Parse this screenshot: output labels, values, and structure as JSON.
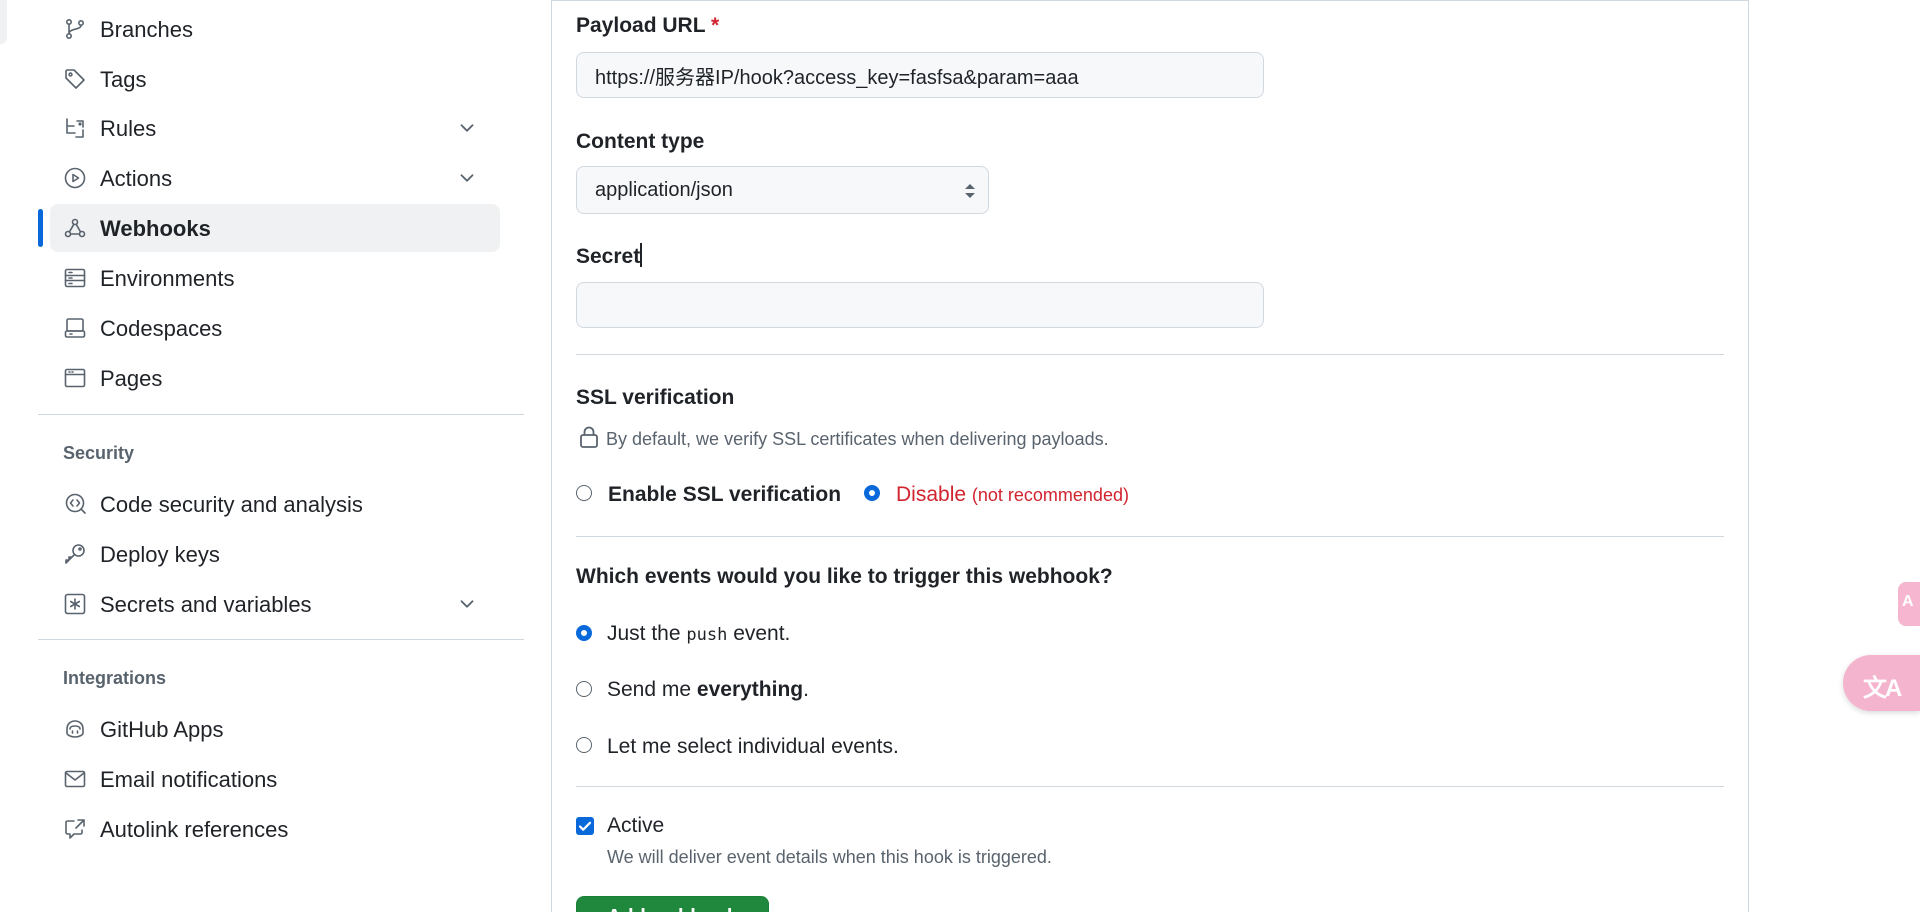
{
  "sidebar": {
    "code_items": [
      {
        "label": "Branches",
        "icon": "git-branch-icon"
      },
      {
        "label": "Tags",
        "icon": "tag-icon"
      },
      {
        "label": "Rules",
        "icon": "rules-icon",
        "expandable": true
      },
      {
        "label": "Actions",
        "icon": "play-icon",
        "expandable": true
      },
      {
        "label": "Webhooks",
        "icon": "webhook-icon",
        "selected": true
      },
      {
        "label": "Environments",
        "icon": "server-icon"
      },
      {
        "label": "Codespaces",
        "icon": "codespaces-icon"
      },
      {
        "label": "Pages",
        "icon": "browser-icon"
      }
    ],
    "security_title": "Security",
    "security_items": [
      {
        "label": "Code security and analysis",
        "icon": "codescan-icon"
      },
      {
        "label": "Deploy keys",
        "icon": "key-icon"
      },
      {
        "label": "Secrets and variables",
        "icon": "asterisk-icon",
        "expandable": true
      }
    ],
    "integrations_title": "Integrations",
    "integrations_items": [
      {
        "label": "GitHub Apps",
        "icon": "copilot-icon"
      },
      {
        "label": "Email notifications",
        "icon": "mail-icon"
      },
      {
        "label": "Autolink references",
        "icon": "cross-reference-icon"
      }
    ]
  },
  "form": {
    "payload_url_label": "Payload URL",
    "required_mark": "*",
    "payload_url_value": "https://服务器IP/hook?access_key=fasfsa&param=aaa",
    "content_type_label": "Content type",
    "content_type_value": "application/json",
    "secret_label": "Secret",
    "secret_value": "",
    "ssl_title": "SSL verification",
    "ssl_note": "By default, we verify SSL certificates when delivering payloads.",
    "ssl_enable_label": "Enable SSL verification",
    "ssl_disable_label": "Disable",
    "ssl_disable_note": "(not recommended)",
    "ssl_selected": "disable",
    "events_title": "Which events would you like to trigger this webhook?",
    "event_push_prefix": "Just the",
    "event_push_code": "push",
    "event_push_suffix": "event.",
    "event_everything_prefix": "Send me",
    "event_everything_strong": "everything",
    "event_everything_suffix": ".",
    "event_individual_label": "Let me select individual events.",
    "events_selected": "push",
    "active_label": "Active",
    "active_checked": true,
    "active_note": "We will deliver event details when this hook is triggered.",
    "add_button_label": "Add webhook"
  },
  "colors": {
    "accent": "#0969da",
    "danger": "#d1242f",
    "primary_button": "#1f883d",
    "translate_widget": "#f5b4ce"
  },
  "translate_widget": {
    "icon": "translate-icon"
  }
}
